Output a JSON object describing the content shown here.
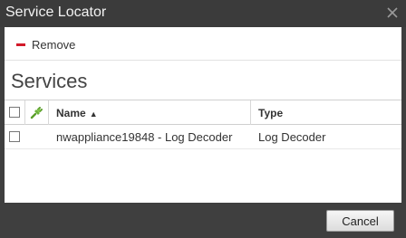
{
  "window": {
    "title": "Service Locator",
    "close_icon": "close-icon"
  },
  "toolbar": {
    "remove_label": "Remove",
    "remove_icon": "minus-icon",
    "accent_color": "#d21a2a"
  },
  "section": {
    "title": "Services"
  },
  "grid": {
    "columns": {
      "name": "Name",
      "type": "Type",
      "status_icon": "plug-icon",
      "sort_icon": "sort-ascending-icon"
    },
    "rows": [
      {
        "name": "nwappliance19848 - Log Decoder",
        "type": "Log Decoder",
        "checked": false
      }
    ]
  },
  "footer": {
    "cancel_label": "Cancel"
  }
}
